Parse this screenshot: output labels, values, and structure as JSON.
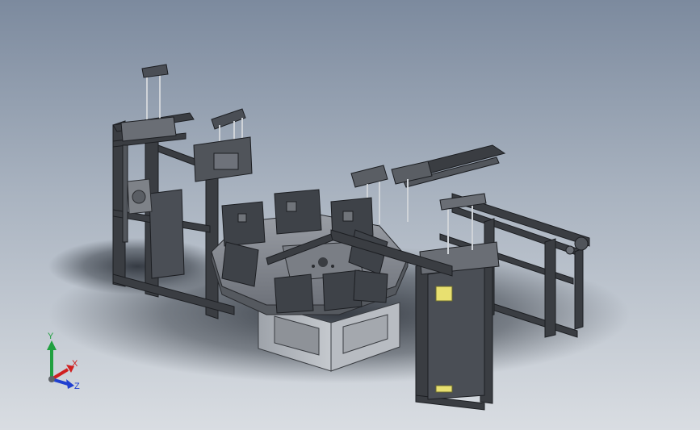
{
  "viewport": {
    "background_top": "#7c8a9e",
    "background_bottom": "#d9dde2"
  },
  "model": {
    "frame_color": "#3a3d42",
    "plate_color": "#8a8e95",
    "accent_yellow": "#e8e070"
  },
  "triad": {
    "x_label": "X",
    "y_label": "Y",
    "z_label": "Z",
    "x_color": "#d02020",
    "y_color": "#20a040",
    "z_color": "#2040d0"
  }
}
